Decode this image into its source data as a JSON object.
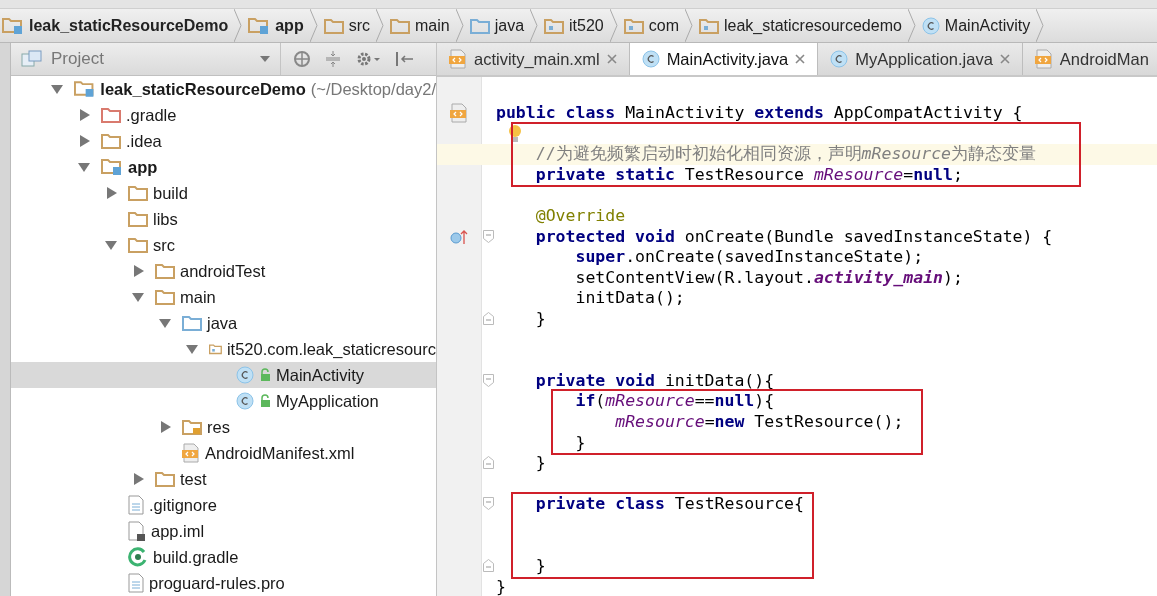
{
  "breadcrumbs": [
    {
      "label": "leak_staticResourceDemo",
      "kind": "module",
      "bold": true
    },
    {
      "label": "app",
      "kind": "module",
      "bold": true
    },
    {
      "label": "src",
      "kind": "folder",
      "bold": false
    },
    {
      "label": "main",
      "kind": "folder",
      "bold": false
    },
    {
      "label": "java",
      "kind": "source-folder",
      "bold": false
    },
    {
      "label": "it520",
      "kind": "package",
      "bold": false
    },
    {
      "label": "com",
      "kind": "package",
      "bold": false
    },
    {
      "label": "leak_staticresourcedemo",
      "kind": "package",
      "bold": false
    },
    {
      "label": "MainActivity",
      "kind": "class",
      "bold": false
    }
  ],
  "project_panel": {
    "title": "Project"
  },
  "tree": [
    {
      "label": "leak_staticResourceDemo",
      "suffix": "(~/Desktop/day2/",
      "kind": "module",
      "bold": true,
      "expanded": true,
      "selected": false,
      "children": [
        {
          "label": ".gradle",
          "kind": "excluded-folder",
          "bold": false,
          "expanded": false,
          "selected": false
        },
        {
          "label": ".idea",
          "kind": "folder",
          "bold": false,
          "expanded": false,
          "selected": false
        },
        {
          "label": "app",
          "kind": "module",
          "bold": true,
          "expanded": true,
          "selected": false,
          "children": [
            {
              "label": "build",
              "kind": "folder",
              "bold": false,
              "expanded": false,
              "selected": false
            },
            {
              "label": "libs",
              "kind": "folder",
              "bold": false,
              "selected": false
            },
            {
              "label": "src",
              "kind": "folder",
              "bold": false,
              "expanded": true,
              "selected": false,
              "children": [
                {
                  "label": "androidTest",
                  "kind": "folder",
                  "bold": false,
                  "expanded": false,
                  "selected": false
                },
                {
                  "label": "main",
                  "kind": "folder",
                  "bold": false,
                  "expanded": true,
                  "selected": false,
                  "children": [
                    {
                      "label": "java",
                      "kind": "source-folder",
                      "bold": false,
                      "expanded": true,
                      "selected": false,
                      "children": [
                        {
                          "label": "it520.com.leak_staticresourc",
                          "kind": "package",
                          "bold": false,
                          "expanded": true,
                          "selected": false,
                          "children": [
                            {
                              "label": "MainActivity",
                              "kind": "class",
                              "bold": false,
                              "selected": true
                            },
                            {
                              "label": "MyApplication",
                              "kind": "class",
                              "bold": false,
                              "selected": false
                            }
                          ]
                        }
                      ]
                    },
                    {
                      "label": "res",
                      "kind": "resource-folder",
                      "bold": false,
                      "expanded": false,
                      "selected": false
                    },
                    {
                      "label": "AndroidManifest.xml",
                      "kind": "xml",
                      "bold": false,
                      "selected": false
                    }
                  ]
                },
                {
                  "label": "test",
                  "kind": "folder",
                  "bold": false,
                  "expanded": false,
                  "selected": false
                }
              ]
            },
            {
              "label": ".gitignore",
              "kind": "text",
              "bold": false,
              "selected": false
            },
            {
              "label": "app.iml",
              "kind": "iml",
              "bold": false,
              "selected": false
            },
            {
              "label": "build.gradle",
              "kind": "gradle",
              "bold": false,
              "selected": false
            },
            {
              "label": "proguard-rules.pro",
              "kind": "text",
              "bold": false,
              "selected": false
            }
          ]
        }
      ]
    }
  ],
  "tabs": [
    {
      "label": "activity_main.xml",
      "kind": "xml",
      "selected": false,
      "closable": true
    },
    {
      "label": "MainActivity.java",
      "kind": "class",
      "selected": true,
      "closable": true
    },
    {
      "label": "MyApplication.java",
      "kind": "class",
      "selected": false,
      "closable": true
    },
    {
      "label": "AndroidMan",
      "kind": "xml",
      "selected": false,
      "closable": false
    }
  ],
  "code_blocks": [
    {
      "lines": [
        {
          "kind": "code",
          "gutter": {
            "kind": "xml"
          },
          "tokens": [
            {
              "kind": "keyword",
              "text": "public class"
            },
            {
              "kind": "plain",
              "text": " MainActivity "
            },
            {
              "kind": "keyword",
              "text": "extends"
            },
            {
              "kind": "plain",
              "text": " AppCompatActivity {"
            }
          ]
        }
      ]
    },
    {
      "boxed": true,
      "lines": [
        {
          "kind": "bulb"
        },
        {
          "kind": "code",
          "current": true,
          "tokens": [
            {
              "kind": "comment",
              "text": "    //为避免频繁启动时初始化相同资源，声明"
            },
            {
              "kind": "comment-field",
              "text": "mResource"
            },
            {
              "kind": "comment",
              "text": "为静态变量"
            }
          ]
        },
        {
          "kind": "code",
          "tokens": [
            {
              "kind": "keyword",
              "text": "    private static"
            },
            {
              "kind": "plain",
              "text": " TestResource "
            },
            {
              "kind": "field",
              "text": "mResource"
            },
            {
              "kind": "plain",
              "text": "="
            },
            {
              "kind": "keyword",
              "text": "null"
            },
            {
              "kind": "plain",
              "text": ";"
            }
          ]
        }
      ]
    },
    {
      "lines": [
        {
          "kind": "blank"
        },
        {
          "kind": "code",
          "tokens": [
            {
              "kind": "annotation",
              "text": "    @Override"
            }
          ]
        },
        {
          "kind": "code",
          "gutter": {
            "kind": "override"
          },
          "fold": {
            "kind": "start"
          },
          "tokens": [
            {
              "kind": "keyword",
              "text": "    protected void"
            },
            {
              "kind": "plain",
              "text": " onCreate(Bundle savedInstanceState) {"
            }
          ]
        },
        {
          "kind": "code",
          "tokens": [
            {
              "kind": "keyword",
              "text": "        super"
            },
            {
              "kind": "plain",
              "text": ".onCreate(savedInstanceState);"
            }
          ]
        },
        {
          "kind": "code",
          "tokens": [
            {
              "kind": "plain",
              "text": "        setContentView(R.layout."
            },
            {
              "kind": "constant",
              "text": "activity_main"
            },
            {
              "kind": "plain",
              "text": ");"
            }
          ]
        },
        {
          "kind": "code",
          "tokens": [
            {
              "kind": "plain",
              "text": "        initData();"
            }
          ]
        },
        {
          "kind": "code",
          "fold": {
            "kind": "end"
          },
          "tokens": [
            {
              "kind": "plain",
              "text": "    }"
            }
          ]
        },
        {
          "kind": "blank"
        },
        {
          "kind": "blank"
        },
        {
          "kind": "code",
          "fold": {
            "kind": "start"
          },
          "tokens": [
            {
              "kind": "keyword",
              "text": "    private void"
            },
            {
              "kind": "plain",
              "text": " initData(){"
            }
          ]
        }
      ]
    },
    {
      "boxed": true,
      "lines": [
        {
          "kind": "code",
          "tokens": [
            {
              "kind": "keyword",
              "text": "        if"
            },
            {
              "kind": "plain",
              "text": "("
            },
            {
              "kind": "field",
              "text": "mResource"
            },
            {
              "kind": "plain",
              "text": "=="
            },
            {
              "kind": "keyword",
              "text": "null"
            },
            {
              "kind": "plain",
              "text": "){"
            }
          ]
        },
        {
          "kind": "code",
          "tokens": [
            {
              "kind": "field",
              "text": "            mResource"
            },
            {
              "kind": "plain",
              "text": "="
            },
            {
              "kind": "keyword",
              "text": "new"
            },
            {
              "kind": "plain",
              "text": " TestResource();"
            }
          ]
        },
        {
          "kind": "code",
          "tokens": [
            {
              "kind": "plain",
              "text": "        }"
            }
          ]
        }
      ]
    },
    {
      "lines": [
        {
          "kind": "code",
          "fold": {
            "kind": "end"
          },
          "tokens": [
            {
              "kind": "plain",
              "text": "    }"
            }
          ]
        },
        {
          "kind": "blank"
        }
      ]
    },
    {
      "boxed": true,
      "lines": [
        {
          "kind": "code",
          "fold": {
            "kind": "start"
          },
          "tokens": [
            {
              "kind": "keyword",
              "text": "    private class"
            },
            {
              "kind": "plain",
              "text": " TestResource{"
            }
          ]
        },
        {
          "kind": "blank"
        },
        {
          "kind": "blank"
        },
        {
          "kind": "code",
          "fold": {
            "kind": "end"
          },
          "tokens": [
            {
              "kind": "plain",
              "text": "    }"
            }
          ]
        }
      ]
    },
    {
      "lines": [
        {
          "kind": "code",
          "tokens": [
            {
              "kind": "plain",
              "text": "}"
            }
          ]
        }
      ]
    }
  ]
}
